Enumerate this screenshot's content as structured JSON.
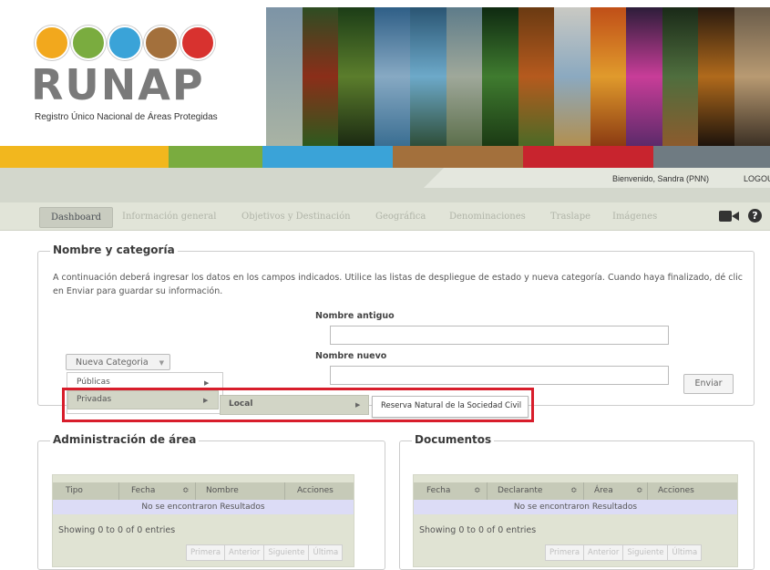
{
  "header": {
    "logo_text": "RUNAP",
    "logo_subtitle": "Registro Único Nacional de Áreas Protegidas",
    "welcome": "Bienvenido, Sandra (PNN)",
    "logout": "LOGOU"
  },
  "tabs": [
    "Dashboard",
    "Información general",
    "Objetivos y Destinación",
    "Geográfica",
    "Denominaciones",
    "Traslape",
    "Imágenes"
  ],
  "nombre_categoria": {
    "legend": "Nombre y categoría",
    "description": "A continuación deberá ingresar los datos en los campos indicados. Utilice las listas de despliegue de estado y nueva categoría. Cuando haya finalizado, dé clic en Enviar para guardar su información.",
    "nombre_antiguo_label": "Nombre antiguo",
    "nombre_nuevo_label": "Nombre nuevo",
    "nombre_antiguo_value": "",
    "nombre_nuevo_value": "",
    "nueva_categoria": "Nueva Categoria",
    "menu_items": [
      "Públicas",
      "Privadas"
    ],
    "submenu_item": "Local",
    "subsubmenu_item": "Reserva Natural de la Sociedad Civil",
    "enviar": "Enviar"
  },
  "administracion": {
    "legend": "Administración de área",
    "columns": [
      "Tipo",
      "Fecha",
      "Nombre",
      "Acciones"
    ],
    "empty": "No se encontraron Resultados",
    "showing": "Showing 0 to 0 of 0 entries",
    "pager": [
      "Primera",
      "Anterior",
      "Siguiente",
      "Última"
    ]
  },
  "documentos": {
    "legend": "Documentos",
    "columns": [
      "Fecha",
      "Declarante",
      "Área",
      "Acciones"
    ],
    "empty": "No se encontraron Resultados",
    "showing": "Showing 0 to 0 of 0 entries",
    "pager": [
      "Primera",
      "Anterior",
      "Siguiente",
      "Última"
    ]
  },
  "colors": {
    "accent_red": "#d81d2b",
    "bar_yellow": "#f2b71e",
    "bar_green": "#7aac3f",
    "bar_blue": "#3aa3d8",
    "bar_brown": "#a3703c",
    "bar_red": "#c8242e",
    "bar_gray": "#6f7b82"
  },
  "icons": [
    "video-camera-icon",
    "help-icon",
    "chevron-down-icon",
    "chevron-right-icon",
    "sort-icon"
  ]
}
